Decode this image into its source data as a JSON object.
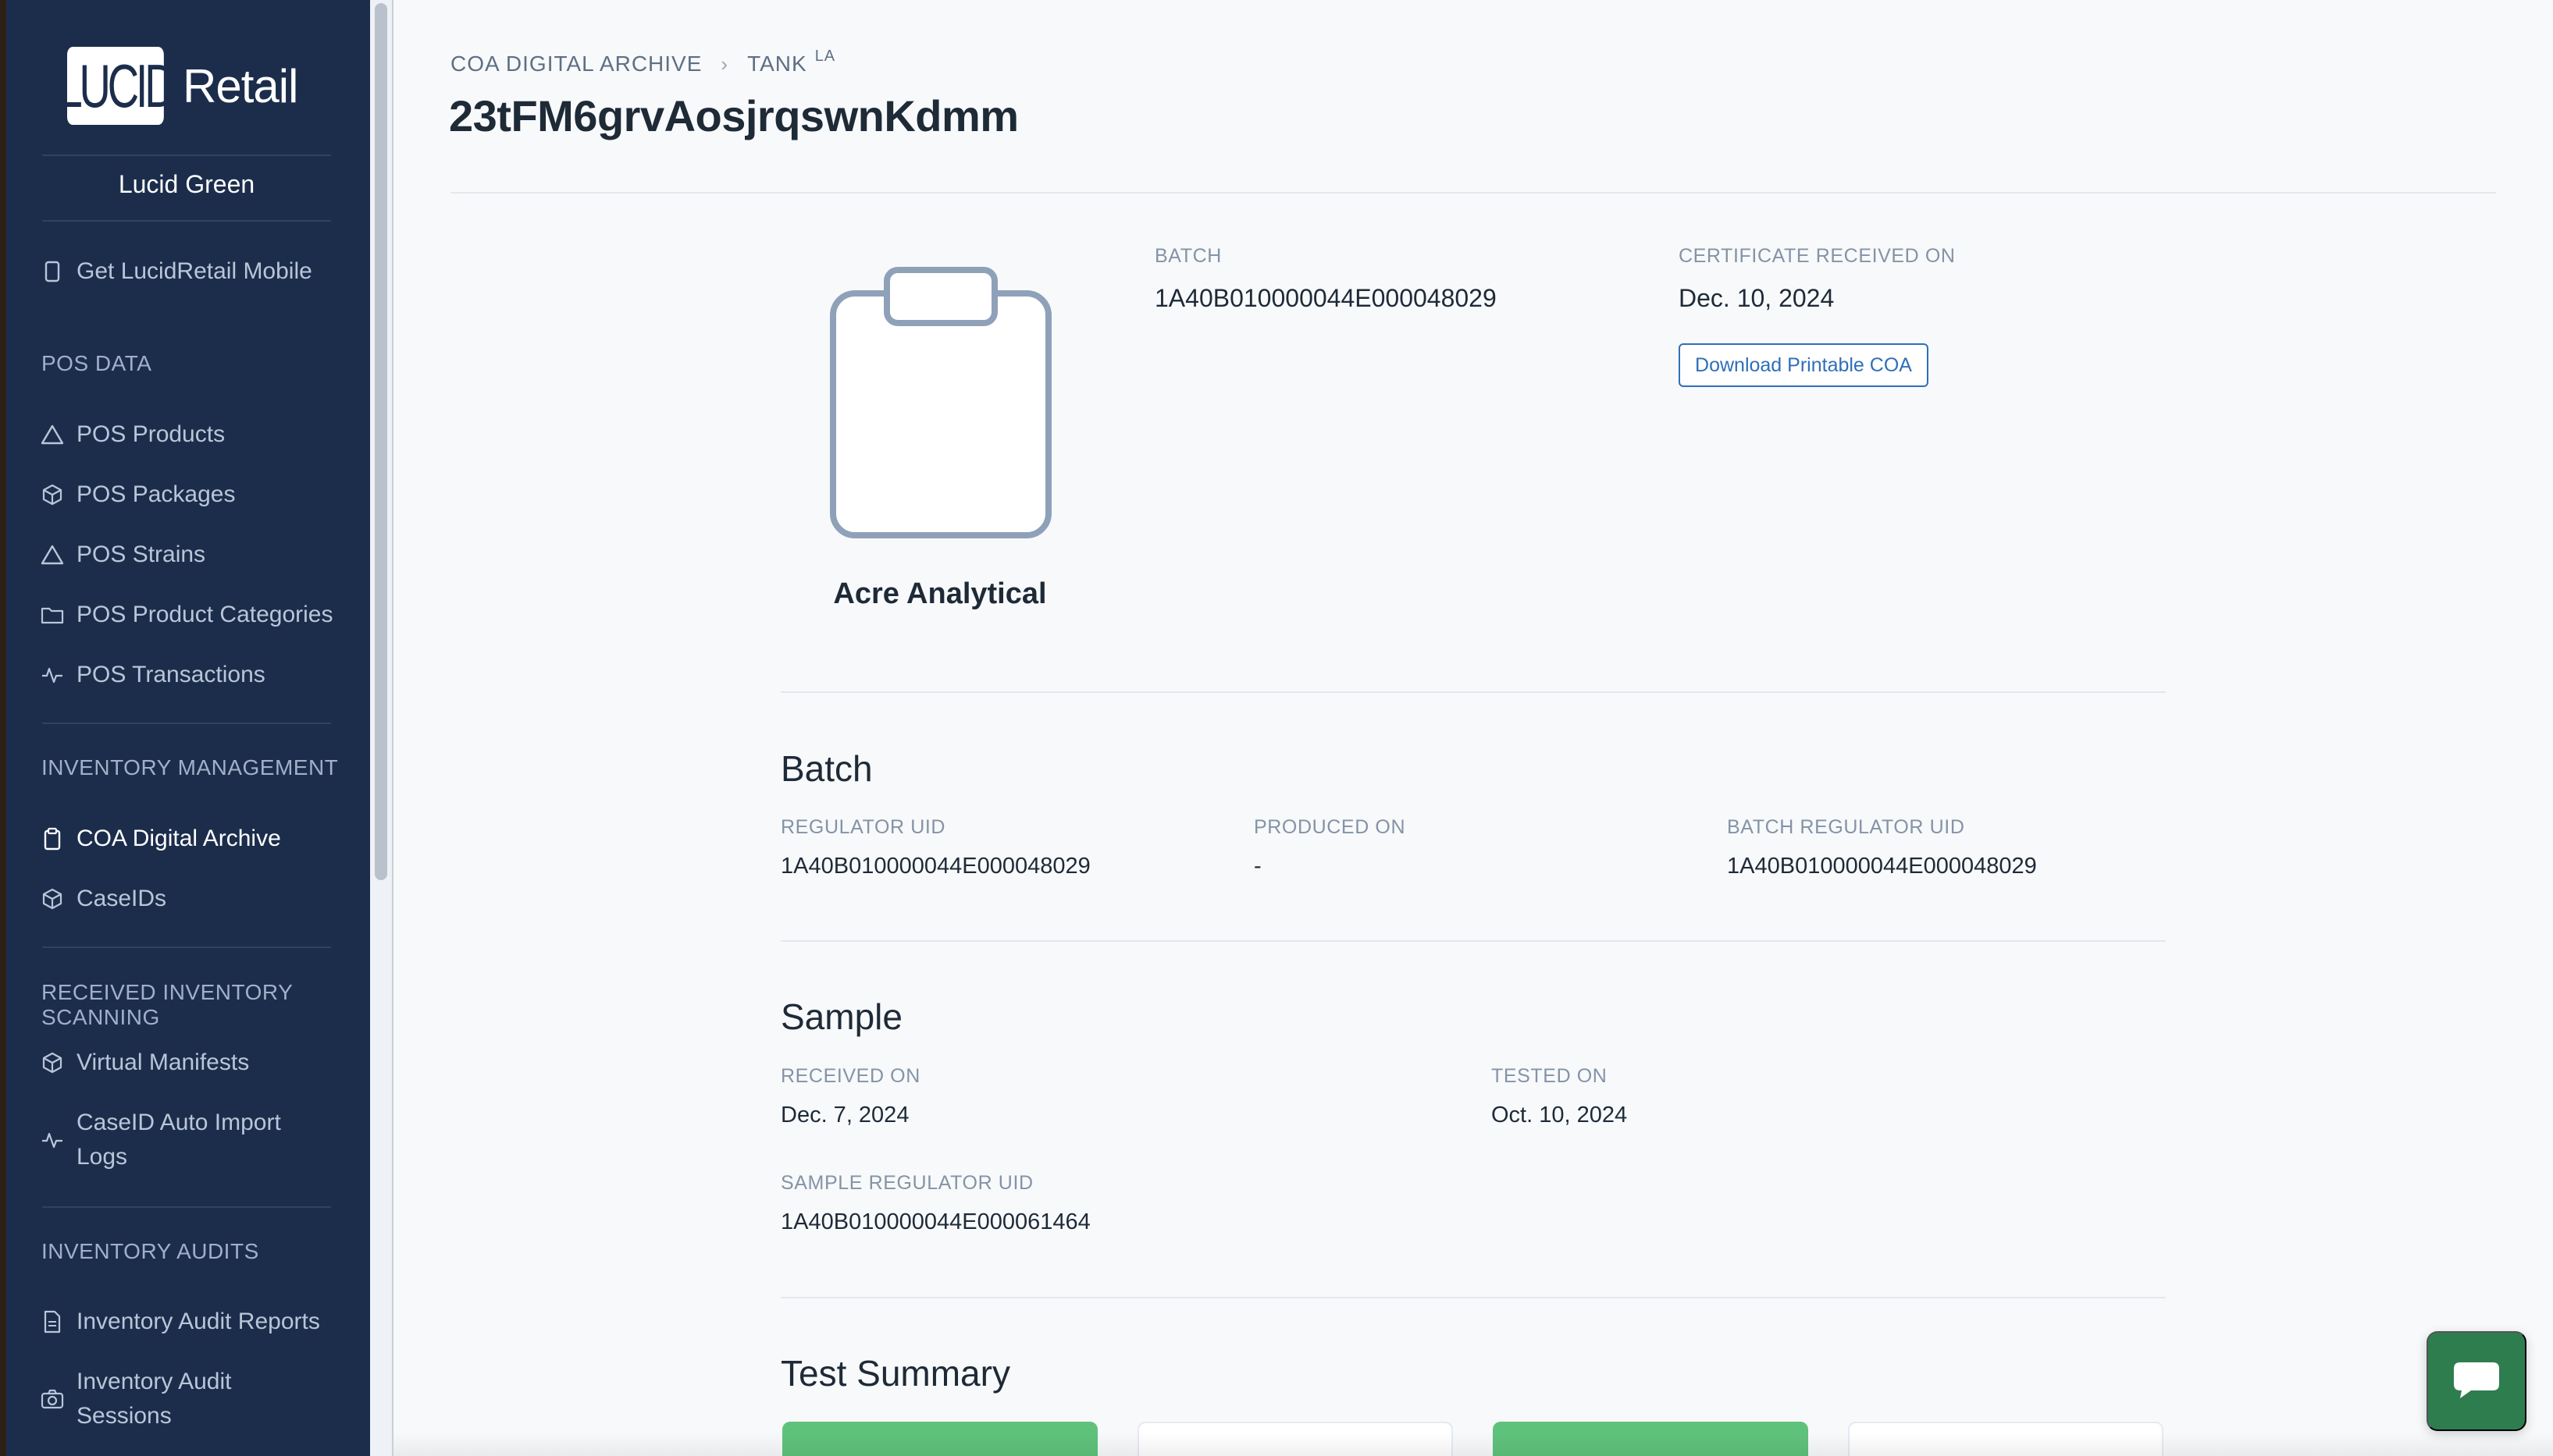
{
  "sidebar": {
    "logo_mark": "LUCID",
    "logo_text": "Retail",
    "user_name": "Lucid Green",
    "mobile_link": "Get LucidRetail Mobile",
    "sections": {
      "pos_data": "POS DATA",
      "inventory_management": "INVENTORY MANAGEMENT",
      "received_inventory_scanning": "RECEIVED INVENTORY SCANNING",
      "inventory_audits": "INVENTORY AUDITS"
    },
    "items": {
      "pos_products": "POS Products",
      "pos_packages": "POS Packages",
      "pos_strains": "POS Strains",
      "pos_product_categories": "POS Product Categories",
      "pos_transactions": "POS Transactions",
      "coa_digital_archive": "COA Digital Archive",
      "caseids": "CaseIDs",
      "virtual_manifests": "Virtual Manifests",
      "caseid_auto_import_logs_1": "CaseID Auto Import",
      "caseid_auto_import_logs_2": "Logs",
      "inventory_audit_reports": "Inventory Audit Reports",
      "inventory_audit_sessions_1": "Inventory Audit",
      "inventory_audit_sessions_2": "Sessions"
    },
    "active_item": "COA Digital Archive"
  },
  "breadcrumb": {
    "root": "COA DIGITAL ARCHIVE",
    "current": "TANK",
    "current_sup": "LA"
  },
  "page_title": "23tFM6grvAosjrqswnKdmm",
  "lab": {
    "name": "Acre Analytical",
    "icon": "clipboard-icon"
  },
  "summary": {
    "batch_label": "BATCH",
    "batch_value": "1A40B010000044E000048029",
    "cert_label": "CERTIFICATE RECEIVED ON",
    "cert_value": "Dec. 10, 2024",
    "download_button": "Download Printable COA"
  },
  "batch_section": {
    "title": "Batch",
    "regulator_uid_label": "REGULATOR UID",
    "regulator_uid_value": "1A40B010000044E000048029",
    "produced_on_label": "PRODUCED ON",
    "produced_on_value": "-",
    "batch_regulator_uid_label": "BATCH REGULATOR UID",
    "batch_regulator_uid_value": "1A40B010000044E000048029"
  },
  "sample_section": {
    "title": "Sample",
    "received_on_label": "RECEIVED ON",
    "received_on_value": "Dec. 7, 2024",
    "tested_on_label": "TESTED ON",
    "tested_on_value": "Oct. 10, 2024",
    "sample_regulator_uid_label": "SAMPLE REGULATOR UID",
    "sample_regulator_uid_value": "1A40B010000044E000061464"
  },
  "test_summary": {
    "title": "Test Summary"
  },
  "colors": {
    "sidebar_bg": "#1c2d4c",
    "accent_blue": "#2f6fba",
    "pass_green": "#5fc27b",
    "chat_green": "#2e7d4f"
  }
}
